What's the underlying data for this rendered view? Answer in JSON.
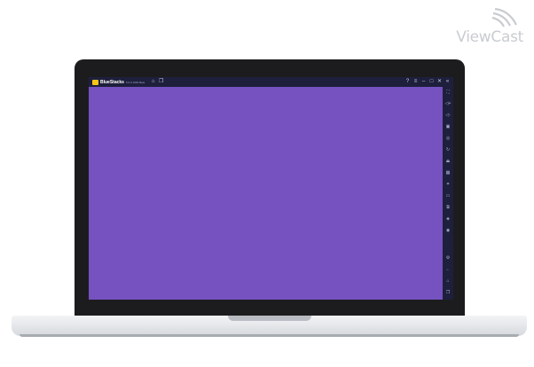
{
  "logo": {
    "text": "ViewCast"
  },
  "window": {
    "title": "BlueStacks",
    "version": "5.0.0.1029 Beta"
  },
  "titlebar_right_icons": [
    "help-icon",
    "menu-icon",
    "minimize-icon",
    "maximize-icon",
    "close-icon",
    "collapse-sidebar-icon"
  ],
  "sidebar_icons": [
    "fullscreen-icon",
    "volume-up-icon",
    "volume-down-icon",
    "media-icon",
    "screenshot-icon",
    "rotate-icon",
    "shake-icon",
    "keyboard-controls-icon",
    "screen-recorder-icon",
    "folder-icon",
    "multi-instance-icon",
    "eco-mode-icon",
    "macro-icon",
    "settings-icon",
    "back-icon",
    "home-icon",
    "recent-apps-icon"
  ],
  "colors": {
    "app_background": "#7552c0",
    "chrome": "#1e1f3c",
    "laptop_bezel": "#1c1c1f"
  }
}
